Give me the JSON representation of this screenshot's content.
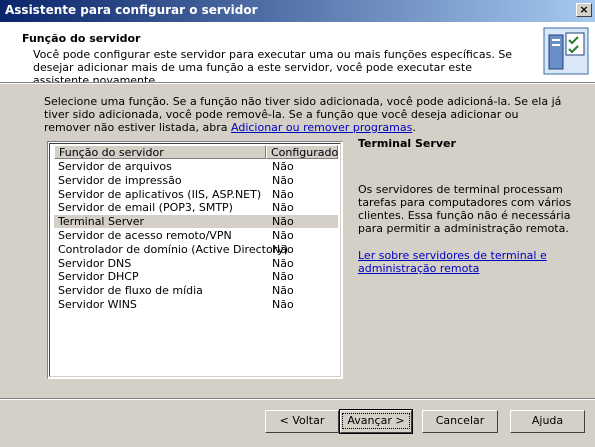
{
  "window": {
    "title": "Assistente para configurar o servidor",
    "close": "×"
  },
  "header": {
    "title": "Função do servidor",
    "description": "Você pode configurar este servidor para executar uma ou mais funções específicas. Se desejar adicionar mais de uma função a este servidor, você pode executar este assistente novamente."
  },
  "intro": {
    "text": "Selecione uma função. Se a função não tiver sido adicionada, você pode adicioná-la. Se ela já tiver sido adicionada, você pode removê-la. Se a função que você deseja adicionar ou remover não estiver listada, abra ",
    "link": "Adicionar ou remover programas",
    "end": "."
  },
  "table": {
    "col_role": "Função do servidor",
    "col_configured": "Configurado",
    "rows": [
      {
        "role": "Servidor de arquivos",
        "configured": "Não"
      },
      {
        "role": "Servidor de impressão",
        "configured": "Não"
      },
      {
        "role": "Servidor de aplicativos (IIS, ASP.NET)",
        "configured": "Não"
      },
      {
        "role": "Servidor de email (POP3, SMTP)",
        "configured": "Não"
      },
      {
        "role": "Terminal Server",
        "configured": "Não"
      },
      {
        "role": "Servidor de acesso remoto/VPN",
        "configured": "Não"
      },
      {
        "role": "Controlador de domínio (Active Directory)",
        "configured": "Não"
      },
      {
        "role": "Servidor DNS",
        "configured": "Não"
      },
      {
        "role": "Servidor DHCP",
        "configured": "Não"
      },
      {
        "role": "Servidor de fluxo de mídia",
        "configured": "Não"
      },
      {
        "role": "Servidor WINS",
        "configured": "Não"
      }
    ]
  },
  "detail": {
    "title": "Terminal Server",
    "description": "Os servidores de terminal processam tarefas para computadores com vários clientes. Essa função não é necessária para permitir a administração remota.",
    "link": "Ler sobre servidores de terminal e administração remota"
  },
  "buttons": {
    "back": "< Voltar",
    "next": "Avançar >",
    "cancel": "Cancelar",
    "help": "Ajuda"
  }
}
